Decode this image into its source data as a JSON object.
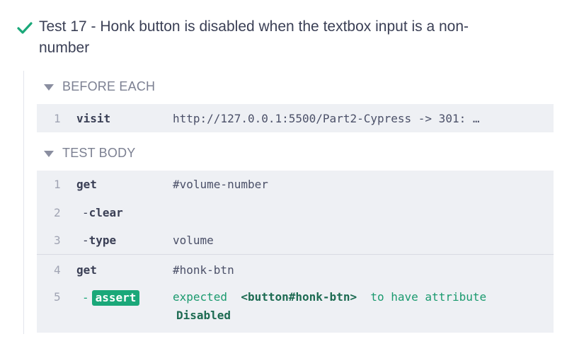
{
  "test": {
    "title_line1": "Test 17 - Honk button is disabled when the textbox input is a non-",
    "title_line2": "number",
    "status_color": "#1aa879"
  },
  "before_each": {
    "heading": "BEFORE EACH",
    "commands": [
      {
        "num": "1",
        "name": "visit",
        "message": "http://127.0.0.1:5500/Part2-Cypress -> 301: …"
      }
    ]
  },
  "test_body": {
    "heading": "TEST BODY",
    "commands": [
      {
        "num": "1",
        "name": "get",
        "message": "#volume-number"
      },
      {
        "num": "2",
        "dash": "-",
        "name": "clear",
        "message": ""
      },
      {
        "num": "3",
        "dash": "-",
        "name": "type",
        "message": "volume"
      },
      {
        "num": "4",
        "name": "get",
        "message": "#honk-btn"
      },
      {
        "num": "5",
        "dash": "-",
        "name": "assert",
        "message_prefix": "expected",
        "message_subject": "<button#honk-btn>",
        "message_suffix": "to have attribute",
        "message_line2": "Disabled"
      }
    ]
  }
}
